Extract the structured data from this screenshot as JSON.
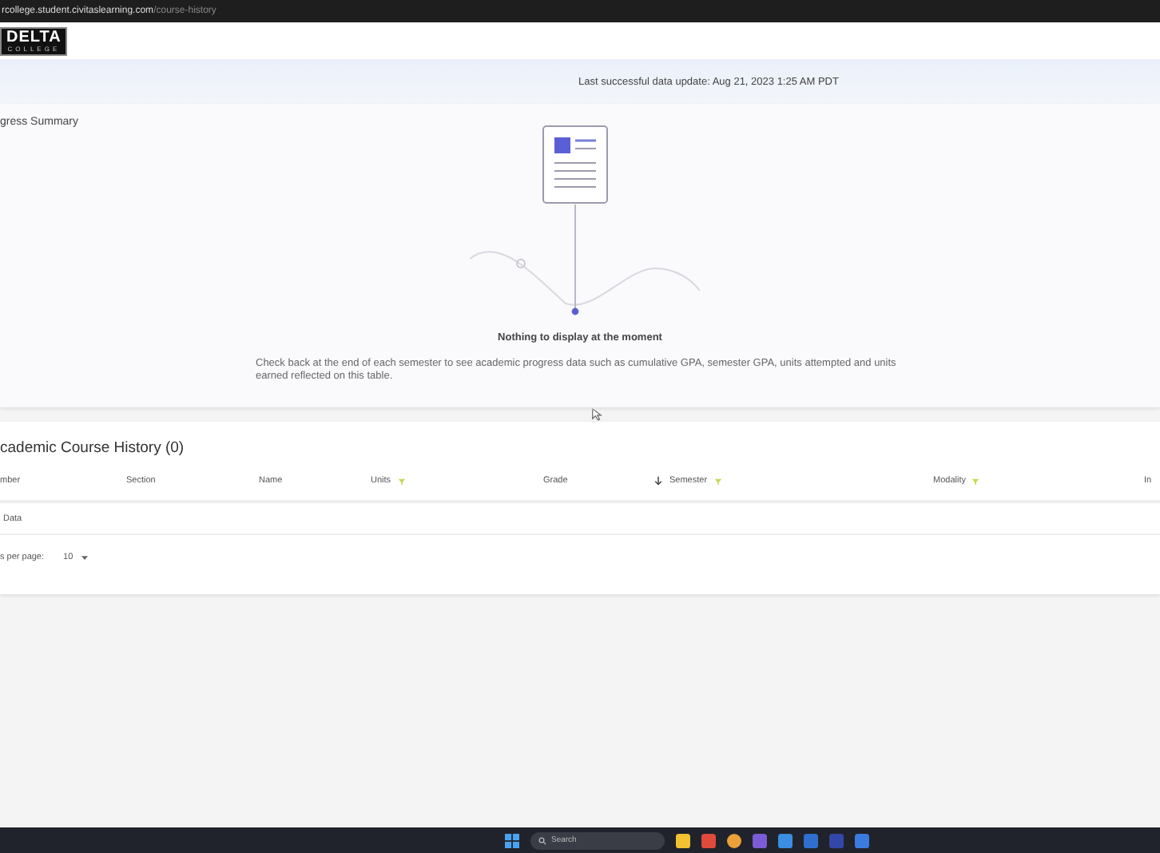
{
  "browser": {
    "url_host": "rcollege.student.civitaslearning.com",
    "url_path": "/course-history"
  },
  "header": {
    "logo_main": "DELTA",
    "logo_sub": "COLLEGE"
  },
  "banner": {
    "text": "Last successful data update: Aug 21, 2023 1:25 AM PDT"
  },
  "progress_summary": {
    "title": "gress Summary",
    "empty_title": "Nothing to display at the moment",
    "empty_message": "Check back at the end of each semester to see academic progress data such as cumulative GPA, semester GPA, units attempted and units earned reflected on this table."
  },
  "course_history": {
    "title": "cademic Course History (0)",
    "columns": [
      {
        "label": "mber",
        "filter": false,
        "sorted": false
      },
      {
        "label": "Section",
        "filter": false,
        "sorted": false
      },
      {
        "label": "Name",
        "filter": false,
        "sorted": false
      },
      {
        "label": "Units",
        "filter": true,
        "sorted": false
      },
      {
        "label": "Grade",
        "filter": false,
        "sorted": false
      },
      {
        "label": "Semester",
        "filter": true,
        "sorted": true
      },
      {
        "label": "Modality",
        "filter": true,
        "sorted": false
      },
      {
        "label": "In",
        "filter": false,
        "sorted": false
      }
    ],
    "empty_text": "Data",
    "rows_per_page_label": "s per page:",
    "rows_per_page_value": "10"
  },
  "taskbar": {
    "search_placeholder": "Search"
  }
}
